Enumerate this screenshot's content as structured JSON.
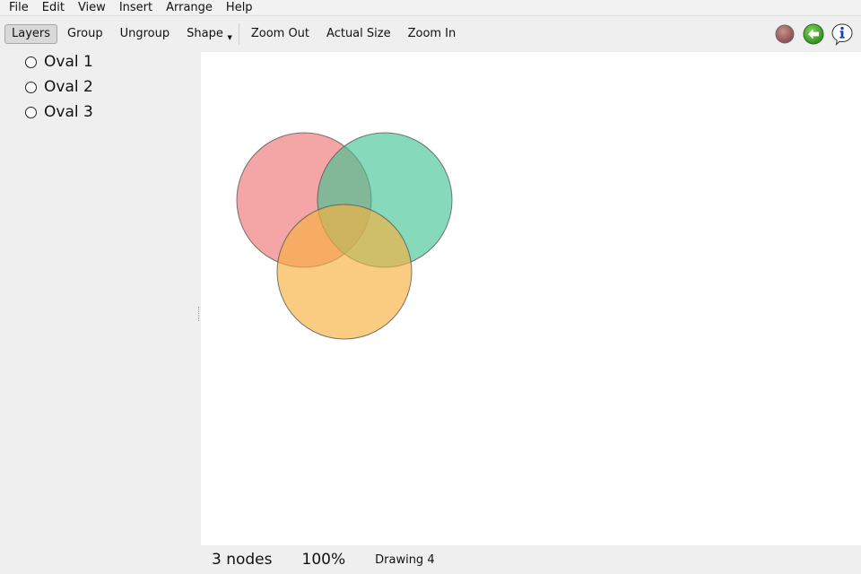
{
  "menubar": {
    "items": [
      "File",
      "Edit",
      "View",
      "Insert",
      "Arrange",
      "Help"
    ]
  },
  "toolbar": {
    "layers_label": "Layers",
    "group_label": "Group",
    "ungroup_label": "Ungroup",
    "shape_label": "Shape",
    "zoom_out_label": "Zoom Out",
    "actual_size_label": "Actual Size",
    "zoom_in_label": "Zoom In",
    "icons": [
      "record-icon",
      "back-arrow-icon",
      "info-icon"
    ]
  },
  "layers": {
    "items": [
      {
        "label": "Oval 1"
      },
      {
        "label": "Oval 2"
      },
      {
        "label": "Oval 3"
      }
    ]
  },
  "canvas": {
    "shapes": [
      {
        "name": "Oval 1",
        "fill": "#f08080"
      },
      {
        "name": "Oval 2",
        "fill": "#3cc28f"
      },
      {
        "name": "Oval 3",
        "fill": "#f8b13f"
      }
    ]
  },
  "status": {
    "nodes": "3 nodes",
    "zoom": "100%",
    "document": "Drawing 4"
  }
}
